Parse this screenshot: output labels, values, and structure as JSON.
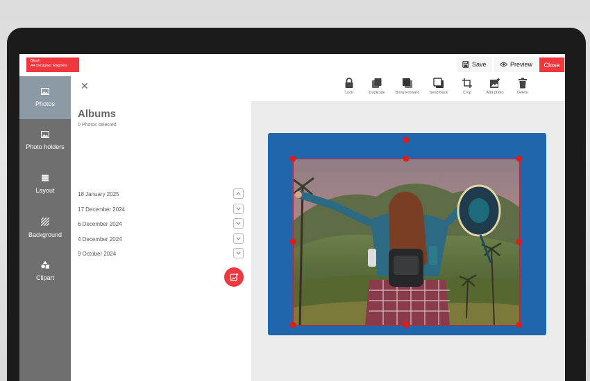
{
  "brand": {
    "line1": "Blush",
    "line2": "A4 Designer Magnets",
    "color": "#f0373e"
  },
  "header": {
    "save_label": "Save",
    "preview_label": "Preview",
    "close_label": "Close",
    "save_icon": "floppy-disk-icon",
    "preview_icon": "eye-icon"
  },
  "sidebar": {
    "items": [
      {
        "label": "Photos",
        "icon": "image-icon",
        "active": true
      },
      {
        "label": "Photo holders",
        "icon": "image-frame-icon",
        "active": false
      },
      {
        "label": "Layout",
        "icon": "layout-grid-icon",
        "active": false
      },
      {
        "label": "Background",
        "icon": "hatch-pattern-icon",
        "active": false
      },
      {
        "label": "Clipart",
        "icon": "shapes-icon",
        "active": false
      }
    ]
  },
  "albums_panel": {
    "title": "Albums",
    "subtitle": "0 Photos selected",
    "albums": [
      {
        "date": "18 January 2025",
        "expanded": true
      },
      {
        "date": "17 December 2024",
        "expanded": false
      },
      {
        "date": "6 December 2024",
        "expanded": false
      },
      {
        "date": "4 December 2024",
        "expanded": false
      },
      {
        "date": "9 October 2024",
        "expanded": false
      }
    ],
    "add_button_icon": "add-photo-icon"
  },
  "toolbar": {
    "tools": [
      {
        "label": "Lock",
        "icon": "lock-icon"
      },
      {
        "label": "Duplicate",
        "icon": "duplicate-icon"
      },
      {
        "label": "Bring Forward",
        "icon": "bring-forward-icon"
      },
      {
        "label": "Send Back",
        "icon": "send-back-icon"
      },
      {
        "label": "Crop",
        "icon": "crop-icon"
      },
      {
        "label": "Add photo",
        "icon": "add-photo-icon"
      },
      {
        "label": "Delete",
        "icon": "trash-icon"
      }
    ]
  },
  "canvas": {
    "background_color": "#1f66ad",
    "selection_color": "#e01b1b",
    "photo_subject": "woman-with-hat-in-mountains-photo"
  }
}
